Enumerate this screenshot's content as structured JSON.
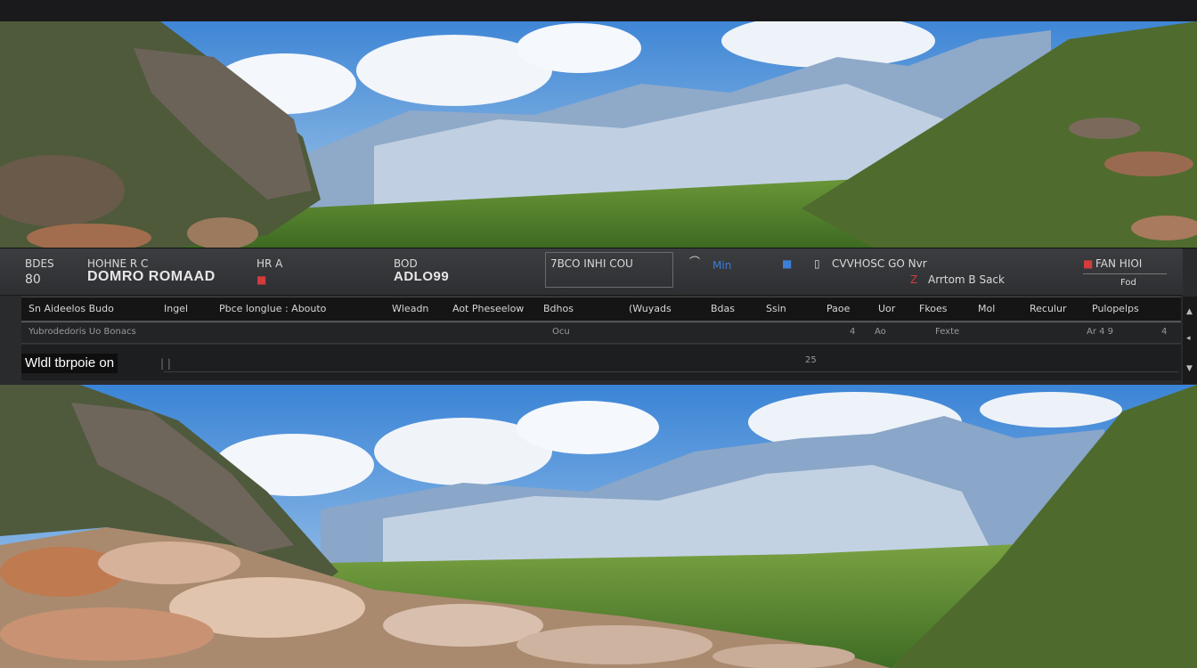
{
  "header": {
    "left_top": "BDES",
    "left_bottom": "80",
    "title_small": "HOHNE  R  C",
    "title_big": "DOMRO ROMAAD",
    "group2_top": "HR   A",
    "group3_top": "BOD",
    "group3_bottom": "ADLO99",
    "group4_top": "7BCO   INHI   COU",
    "group5_top": "Min",
    "group6_top": "CVVHOSC   GO Nvr",
    "group6_bottom": "Arrtom   B   Sack",
    "group7_top": "FAN HIOI",
    "group7_bottom": "Fod"
  },
  "columns": [
    "Sn Aideelos Budo",
    "Ingel",
    "Pbce  longlue : Abouto",
    "Wleadn",
    "Aot Pheseelow",
    "Bdhos",
    "(Wuyads",
    "Bdas",
    "Ssin",
    "Paoe",
    "Uor",
    "Fkoes",
    "Mol",
    "Reculur",
    "Pulopelps"
  ],
  "row1": {
    "left": "Yubrodedoris   Uo  Bonacs",
    "mid": "Ocu",
    "c1": "4",
    "c2": "Ao",
    "c3": "Fexte",
    "c4": "Ar  4  9",
    "c5": "4"
  },
  "row2": {
    "label": "Wldl tbrpoie on",
    "cursor": "| |",
    "mark": "25"
  },
  "scrollbar": {
    "up": "▲",
    "down": "▼",
    "knob": "◂"
  },
  "colors": {
    "panel": "#2a2b2d",
    "header": "#3c3d40",
    "accent_red": "#d23c3c",
    "accent_blue": "#3d7fd8",
    "sky": "#5b9bd8"
  }
}
